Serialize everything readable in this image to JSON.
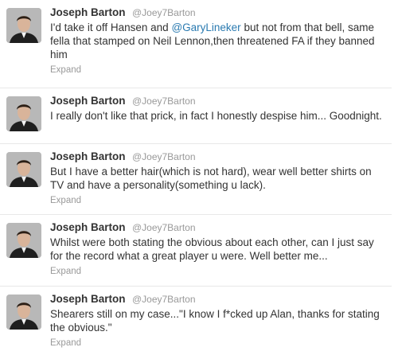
{
  "author": {
    "name": "Joseph Barton",
    "handle": "@Joey7Barton"
  },
  "expand_label": "Expand",
  "tweets": [
    {
      "parts": [
        "I'd take it off Hansen and ",
        "@GaryLineker",
        " but not from that bell, same fella that stamped on Neil Lennon,then threatened FA if they banned him"
      ]
    },
    {
      "text": "I really don't like that prick, in fact I honestly despise him... Goodnight."
    },
    {
      "text": "But I have a better hair(which is not hard), wear well better shirts on TV and have a personality(something u lack)."
    },
    {
      "text": "Whilst were both stating the obvious about each other, can I just say for the record what a great player u were. Well better me..."
    },
    {
      "text": "Shearers still on my case...\"I know I f*cked up Alan, thanks for stating the obvious.\""
    }
  ],
  "colors": {
    "name": "#333333",
    "handle": "#999999",
    "mention": "#2a7ab0",
    "divider": "#e8e8e8"
  }
}
